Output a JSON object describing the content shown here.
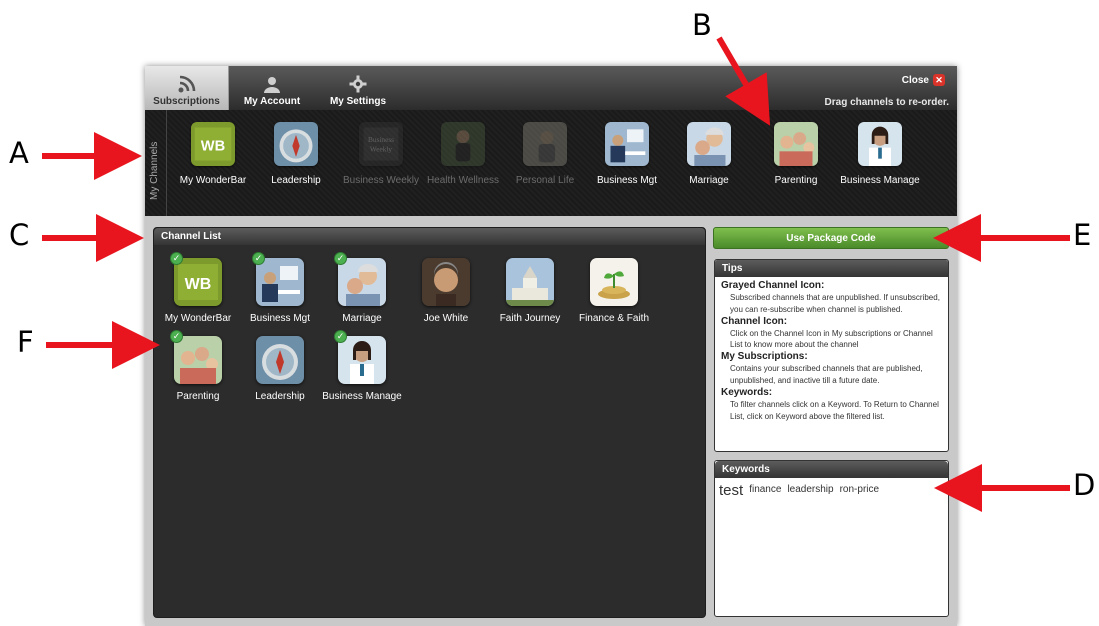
{
  "tabs": [
    {
      "label": "Subscriptions"
    },
    {
      "label": "My Account"
    },
    {
      "label": "My Settings"
    }
  ],
  "header": {
    "close_label": "Close",
    "drag_hint": "Drag channels to re-order."
  },
  "my_channels": {
    "title": "My Channels",
    "items": [
      {
        "label": "My WonderBar",
        "icon": "wonderbar-logo",
        "grayed": false
      },
      {
        "label": "Leadership",
        "icon": "compass-image",
        "grayed": false
      },
      {
        "label": "Business Weekly",
        "icon": "business-weekly-image",
        "grayed": true
      },
      {
        "label": "Health Wellness",
        "icon": "health-wellness-image",
        "grayed": true
      },
      {
        "label": "Personal Life",
        "icon": "personal-life-image",
        "grayed": true
      },
      {
        "label": "Business Mgt",
        "icon": "business-meeting-image",
        "grayed": false
      },
      {
        "label": "Marriage",
        "icon": "couple-image",
        "grayed": false
      },
      {
        "label": "Parenting",
        "icon": "family-image",
        "grayed": false
      },
      {
        "label": "Business Manage",
        "icon": "doctor-image",
        "grayed": false
      }
    ]
  },
  "channel_list": {
    "title": "Channel List",
    "items": [
      {
        "label": "My WonderBar",
        "icon": "wonderbar-logo",
        "subscribed": true
      },
      {
        "label": "Business Mgt",
        "icon": "business-meeting-image",
        "subscribed": true
      },
      {
        "label": "Marriage",
        "icon": "couple-image",
        "subscribed": true
      },
      {
        "label": "Joe White",
        "icon": "portrait-image",
        "subscribed": false
      },
      {
        "label": "Faith Journey",
        "icon": "church-image",
        "subscribed": false
      },
      {
        "label": "Finance & Faith",
        "icon": "coins-plant-image",
        "subscribed": false
      },
      {
        "label": "Parenting",
        "icon": "family-image",
        "subscribed": true
      },
      {
        "label": "Leadership",
        "icon": "compass-image",
        "subscribed": false
      },
      {
        "label": "Business Manage",
        "icon": "doctor-image",
        "subscribed": true
      }
    ]
  },
  "package_button": {
    "label": "Use Package Code"
  },
  "tips": {
    "title": "Tips",
    "sections": [
      {
        "heading": "Grayed Channel Icon:",
        "text": "Subscribed channels that are unpublished. If unsubscribed, you can re-subscribe when channel is published."
      },
      {
        "heading": "Channel Icon:",
        "text": "Click on the Channel Icon in My subscriptions or Channel List to know more about the channel"
      },
      {
        "heading": "My Subscriptions:",
        "text": "Contains your subscribed channels that are published, unpublished, and inactive till a future date."
      },
      {
        "heading": "Keywords:",
        "text": "To filter channels click on a Keyword. To Return to Channel List, click on Keyword above the filtered list."
      }
    ]
  },
  "keywords": {
    "title": "Keywords",
    "items": [
      "test",
      "finance",
      "leadership",
      "ron-price"
    ]
  },
  "callouts": {
    "A": "A",
    "B": "B",
    "C": "C",
    "D": "D",
    "E": "E",
    "F": "F"
  },
  "colors": {
    "accent_green": "#5a9a35",
    "callout_red": "#e8141e",
    "check_green": "#4caf50"
  }
}
